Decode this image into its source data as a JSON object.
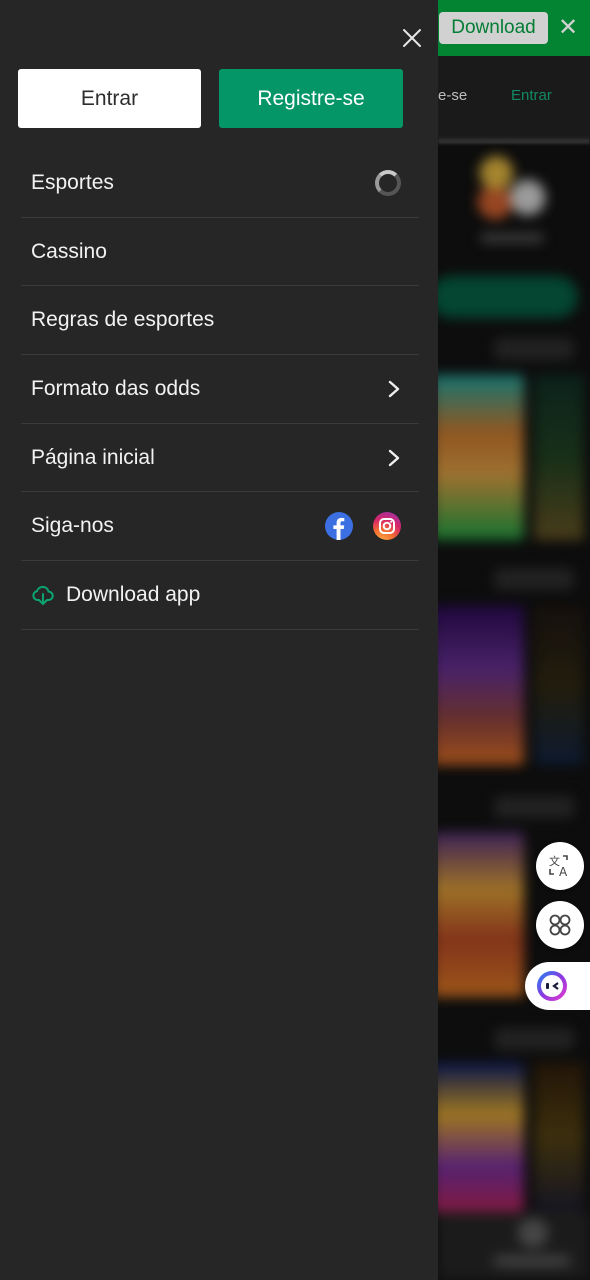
{
  "banner": {
    "download_label": "Download",
    "close_glyph": "✕"
  },
  "background_header": {
    "register_partial": "e-se",
    "login_label": "Entrar"
  },
  "drawer": {
    "close_icon": "close-icon",
    "login_button": "Entrar",
    "register_button": "Registre-se",
    "menu": [
      {
        "label": "Esportes",
        "trailing": "loading-spinner"
      },
      {
        "label": "Cassino",
        "trailing": ""
      },
      {
        "label": "Regras de esportes",
        "trailing": ""
      },
      {
        "label": "Formato das odds",
        "trailing": "chevron-right-icon"
      },
      {
        "label": "Página inicial",
        "trailing": "chevron-right-icon"
      },
      {
        "label": "Siga-nos",
        "trailing": "social",
        "social": [
          "facebook-icon",
          "instagram-icon"
        ]
      },
      {
        "label": "Download app",
        "leading": "cloud-download-icon"
      }
    ]
  },
  "floating_buttons": [
    "translate-icon",
    "apps-icon",
    "chatbot-icon"
  ],
  "colors": {
    "brand_green": "#049667",
    "banner_green": "#04a13f",
    "drawer_bg": "#262626",
    "facebook_blue": "#3b6fe2"
  }
}
